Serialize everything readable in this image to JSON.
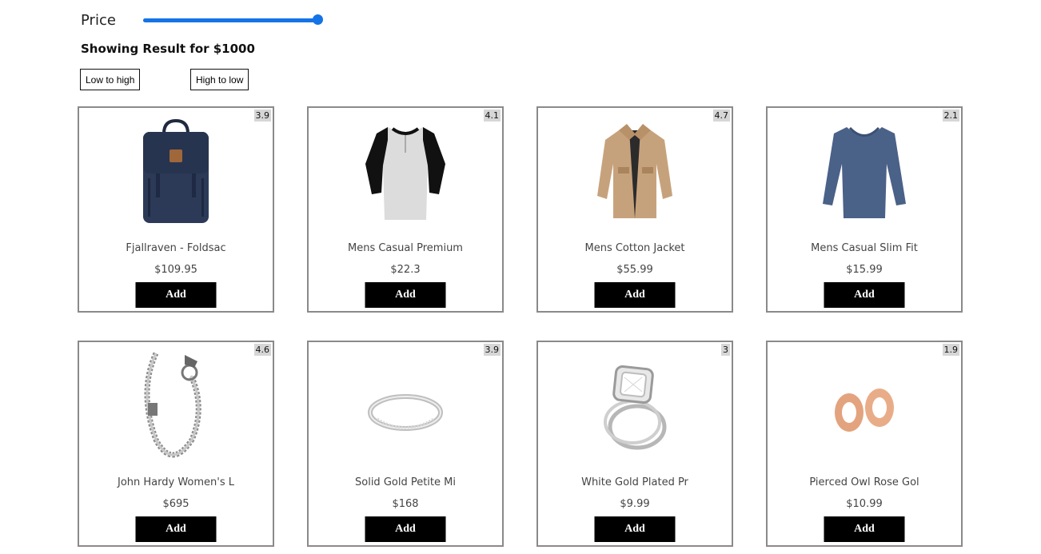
{
  "filters": {
    "price_label": "Price",
    "price_slider_value": 1000,
    "price_slider_max": 1000,
    "accent_color": "#1473e6",
    "result_text": "Showing Result for $1000",
    "sort_low_to_high": "Low to high",
    "sort_high_to_low": "High to low"
  },
  "products": [
    {
      "name": "Fjallraven - Foldsac",
      "price": "$109.95",
      "rating": "3.9",
      "add_label": "Add",
      "icon": "backpack-image"
    },
    {
      "name": "Mens Casual Premium",
      "price": "$22.3",
      "rating": "4.1",
      "add_label": "Add",
      "icon": "raglan-tshirt-image"
    },
    {
      "name": "Mens Cotton Jacket",
      "price": "$55.99",
      "rating": "4.7",
      "add_label": "Add",
      "icon": "jacket-image"
    },
    {
      "name": "Mens Casual Slim Fit",
      "price": "$15.99",
      "rating": "2.1",
      "add_label": "Add",
      "icon": "longsleeve-shirt-image"
    },
    {
      "name": "John Hardy Women's L",
      "price": "$695",
      "rating": "4.6",
      "add_label": "Add",
      "icon": "bracelet-image"
    },
    {
      "name": "Solid Gold Petite Mi",
      "price": "$168",
      "rating": "3.9",
      "add_label": "Add",
      "icon": "ring-image"
    },
    {
      "name": "White Gold Plated Pr",
      "price": "$9.99",
      "rating": "3",
      "add_label": "Add",
      "icon": "diamond-ring-image"
    },
    {
      "name": "Pierced Owl Rose Gol",
      "price": "$10.99",
      "rating": "1.9",
      "add_label": "Add",
      "icon": "rose-gold-plugs-image"
    }
  ]
}
